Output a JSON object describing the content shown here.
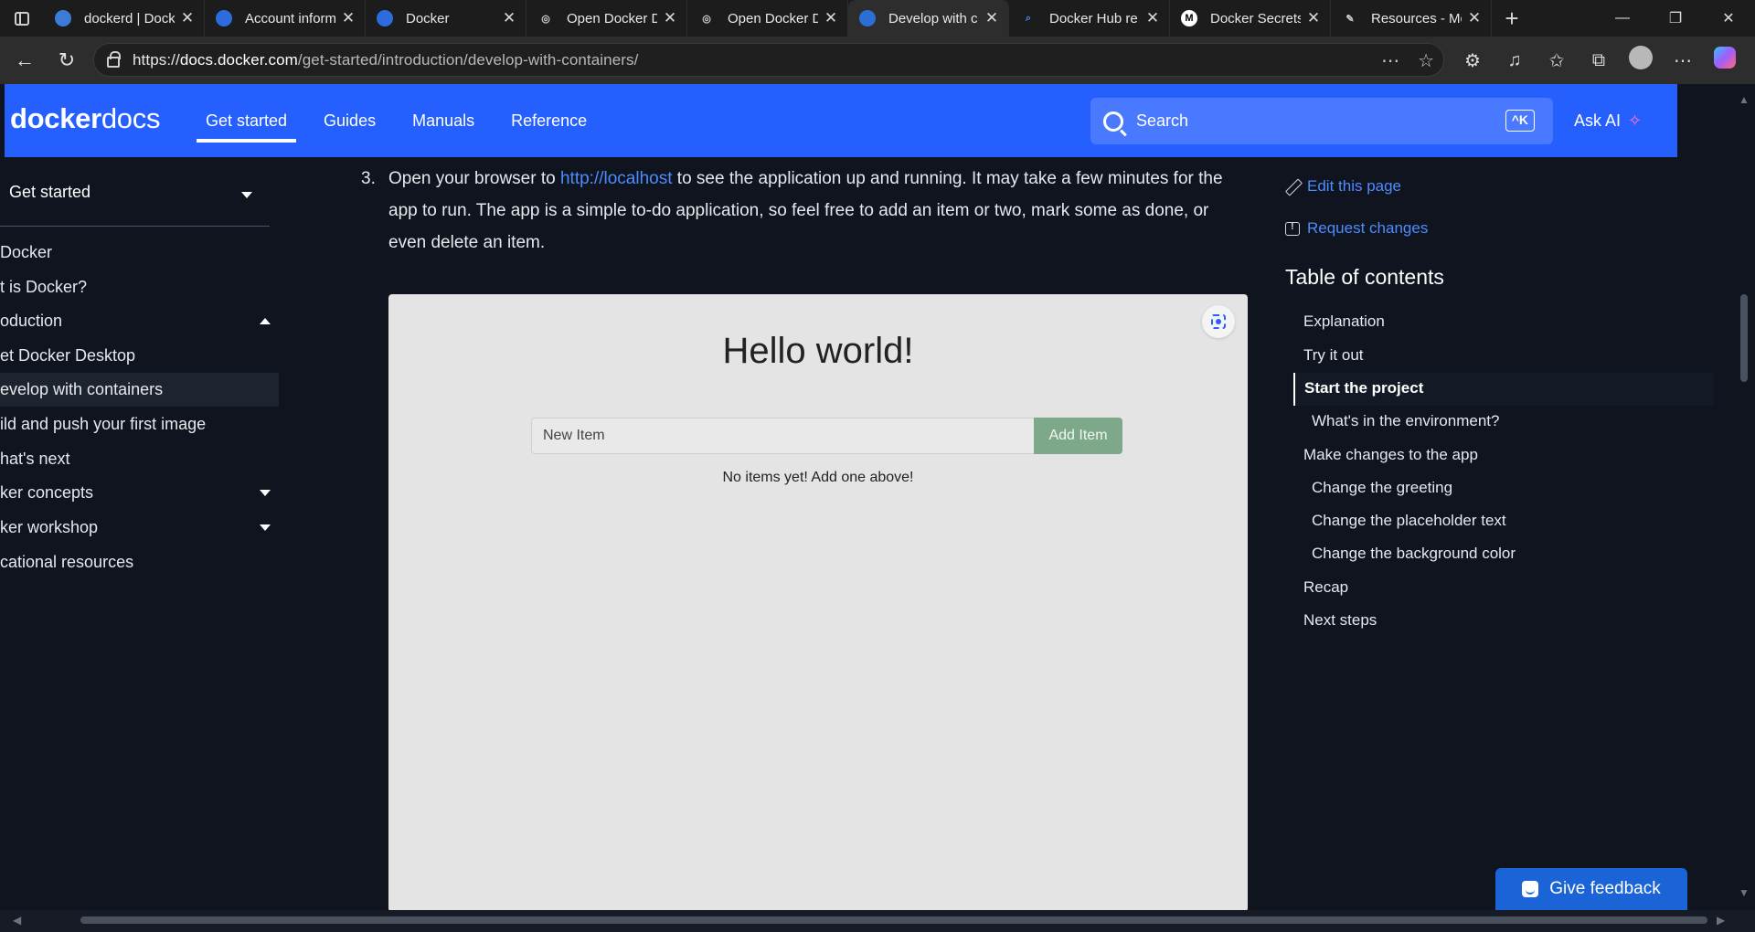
{
  "browser": {
    "tabs": [
      {
        "title": "dockerd | Dock",
        "favicon": "docker-globe-icon",
        "active": false
      },
      {
        "title": "Account inform",
        "favicon": "docker-whale-icon",
        "active": false
      },
      {
        "title": "Docker",
        "favicon": "docker-whale-icon",
        "active": false
      },
      {
        "title": "Open Docker D",
        "favicon": "globe-icon",
        "active": false
      },
      {
        "title": "Open Docker D",
        "favicon": "globe-icon",
        "active": false
      },
      {
        "title": "Develop with c",
        "favicon": "docker-docs-icon",
        "active": true
      },
      {
        "title": "Docker Hub re",
        "favicon": "search-icon",
        "active": false
      },
      {
        "title": "Docker Secrets",
        "favicon": "medium-icon",
        "active": false
      },
      {
        "title": "Resources - Mc",
        "favicon": "resources-icon",
        "active": false
      }
    ],
    "url": {
      "scheme": "https://",
      "host": "docs.docker.com",
      "path": "/get-started/introduction/develop-with-containers/"
    }
  },
  "header": {
    "logo": {
      "bold": "docker",
      "light": "docs"
    },
    "nav": [
      {
        "label": "Get started",
        "active": true
      },
      {
        "label": "Guides",
        "active": false
      },
      {
        "label": "Manuals",
        "active": false
      },
      {
        "label": "Reference",
        "active": false
      }
    ],
    "search": {
      "placeholder": "Search",
      "shortcut": "^K"
    },
    "ask_ai": "Ask AI"
  },
  "sidebar": {
    "section": "Get started",
    "items": [
      {
        "label": "Docker",
        "state": "none"
      },
      {
        "label": "t is Docker?",
        "state": "none"
      },
      {
        "label": "oduction",
        "state": "expanded"
      },
      {
        "label": "et Docker Desktop",
        "state": "none"
      },
      {
        "label": "evelop with containers",
        "state": "active"
      },
      {
        "label": "ild and push your first image",
        "state": "none"
      },
      {
        "label": "hat's next",
        "state": "none"
      },
      {
        "label": "ker concepts",
        "state": "collapsed"
      },
      {
        "label": "ker workshop",
        "state": "collapsed"
      },
      {
        "label": "cational resources",
        "state": "none"
      }
    ]
  },
  "main": {
    "step_number": "3.",
    "step_text_before": "Open your browser to ",
    "step_link": "http://localhost",
    "step_text_after": " to see the application up and running. It may take a few minutes for the app to run. The app is a simple to-do application, so feel free to add an item or two, mark some as done, or even delete an item.",
    "app": {
      "title": "Hello world!",
      "input_placeholder": "New Item",
      "add_button": "Add Item",
      "empty_message": "No items yet! Add one above!"
    }
  },
  "aside": {
    "edit_link": "Edit this page",
    "request_link": "Request changes",
    "toc_title": "Table of contents",
    "toc": [
      {
        "label": "Explanation",
        "level": 1
      },
      {
        "label": "Try it out",
        "level": 1
      },
      {
        "label": "Start the project",
        "level": 1,
        "active": true
      },
      {
        "label": "What's in the environment?",
        "level": 2
      },
      {
        "label": "Make changes to the app",
        "level": 1
      },
      {
        "label": "Change the greeting",
        "level": 2
      },
      {
        "label": "Change the placeholder text",
        "level": 2
      },
      {
        "label": "Change the background color",
        "level": 2
      },
      {
        "label": "Recap",
        "level": 1
      },
      {
        "label": "Next steps",
        "level": 1
      }
    ]
  },
  "feedback_button": "Give feedback",
  "colors": {
    "brand_blue": "#2560ff",
    "page_bg": "#0f141e",
    "link": "#4c8cff",
    "add_button": "#7ea88a"
  }
}
